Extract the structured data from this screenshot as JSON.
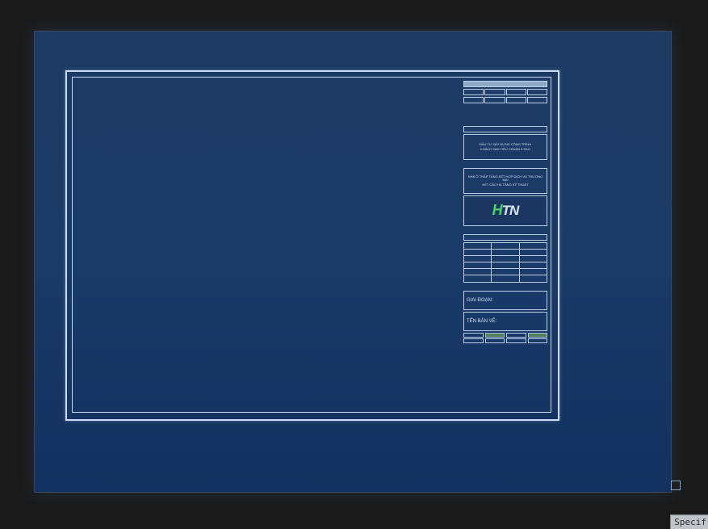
{
  "titleblock": {
    "header_cells": [
      "",
      "",
      ""
    ],
    "header_cells_b": [
      "",
      "",
      "",
      ""
    ],
    "header_cells_c": [
      "",
      "",
      "",
      ""
    ],
    "info1": {
      "line1": "ĐẦU TƯ XÂY DỰNG CÔNG TRÌNH",
      "line2": "KHÁCH SẠN TIÊU CHUẨN 5 SAO"
    },
    "info2": {
      "line1": "NHÀ Ở THẤP TẦNG KẾT HỢP DỊCH VỤ THƯƠNG MẠI",
      "line2": "KẾT CẤU HẠ TẦNG KỸ THUẬT"
    },
    "logo": {
      "left": "H",
      "right": "TN"
    },
    "table_rows": 6,
    "table_cols": 3,
    "name_label": "GIAI ĐOẠN: ",
    "drawing_label": "TÊN BẢN VẼ:",
    "footer": {
      "row1": [
        "",
        "",
        "",
        ""
      ],
      "row2": [
        "",
        "",
        "",
        ""
      ],
      "row3": [
        "",
        "",
        "",
        ""
      ]
    }
  },
  "command": {
    "prefix": "Specif"
  }
}
